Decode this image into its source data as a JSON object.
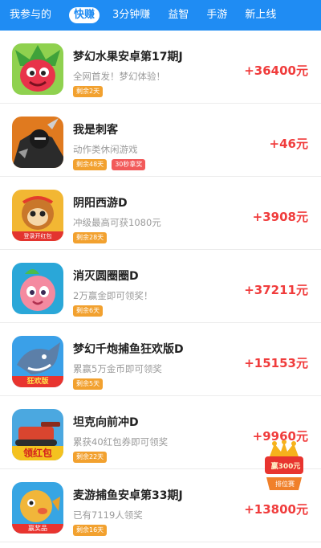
{
  "tabs": [
    {
      "label": "我参与的",
      "active": false
    },
    {
      "label": "快赚",
      "active": true
    },
    {
      "label": "3分钟赚",
      "active": false
    },
    {
      "label": "益智",
      "active": false
    },
    {
      "label": "手游",
      "active": false
    },
    {
      "label": "新上线",
      "active": false
    }
  ],
  "colors": {
    "accent": "#1f8cf3",
    "reward": "#f03c3c",
    "tag_orange": "#f2a12f",
    "tag_red": "#f25a5a"
  },
  "games": [
    {
      "title": "梦幻水果安卓第17期J",
      "desc": "全网首发！梦幻体验！",
      "tags": [
        "剩余2天"
      ],
      "reward": "+36400元",
      "icon": "dragon-fruit-icon"
    },
    {
      "title": "我是刺客",
      "desc": "动作类休闲游戏",
      "tags": [
        "剩余48天",
        "30秒拿奖"
      ],
      "reward": "+46元",
      "icon": "assassin-icon"
    },
    {
      "title": "阴阳西游D",
      "desc": "冲级最高可获1080元",
      "tags": [
        "剩余28天"
      ],
      "reward": "+3908元",
      "icon": "monkey-king-icon",
      "icon_text": "登录开红包"
    },
    {
      "title": "消灭圆圈圈D",
      "desc": "2万赢金即可领奖！",
      "tags": [
        "剩余6天"
      ],
      "reward": "+37211元",
      "icon": "peach-icon"
    },
    {
      "title": "梦幻千炮捕鱼狂欢版D",
      "desc": "累赢5万金币即可领奖",
      "tags": [
        "剩余5天"
      ],
      "reward": "+15153元",
      "icon": "shark-icon",
      "icon_text": "狂欢版"
    },
    {
      "title": "坦克向前冲D",
      "desc": "累获40红包券即可领奖",
      "tags": [
        "剩余22天"
      ],
      "reward": "+9960元",
      "icon": "tank-icon",
      "icon_text": "领红包"
    },
    {
      "title": "麦游捕鱼安卓第33期J",
      "desc": "已有7119人领奖",
      "tags": [
        "剩余16天"
      ],
      "reward": "+13800元",
      "icon": "pufferfish-icon",
      "icon_text": "赢奖品"
    }
  ],
  "badge": {
    "amount": "赢300元",
    "label": "排位赛"
  }
}
